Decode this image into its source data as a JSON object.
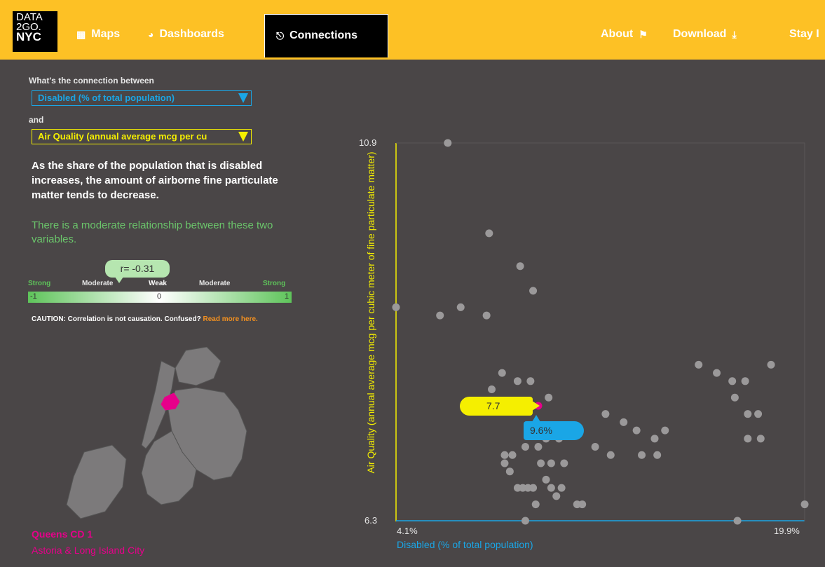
{
  "logo": {
    "line1": "DATA",
    "line2": "2GO.",
    "line3": "NYC"
  },
  "nav": {
    "maps": "Maps",
    "dashboards": "Dashboards",
    "connections": "Connections",
    "about": "About",
    "download": "Download",
    "stay": "Stay I"
  },
  "panel": {
    "question": "What's the connection between",
    "var1": "Disabled (% of total population)",
    "and": "and",
    "var2": "Air Quality (annual average mcg per cu",
    "statement": "As the share of the population that is disabled increases, the amount of airborne fine particulate matter tends to decrease.",
    "relationship": "There is a moderate relationship between these two variables.",
    "r_value": "r= -0.31",
    "r": -0.31,
    "scale_labels": [
      "Strong",
      "Moderate",
      "Weak",
      "Moderate",
      "Strong"
    ],
    "scale_min": "-1",
    "scale_mid": "0",
    "scale_max": "1",
    "caution": "CAUTION: Correlation is not causation. Confused?",
    "caution_link": "Read more here."
  },
  "selected": {
    "district": "Queens CD 1",
    "neighborhood": "Astoria & Long Island City",
    "x_label": "9.6%",
    "y_label": "7.7"
  },
  "colors": {
    "accent": "#fdc125",
    "x_var": "#1aa6e6",
    "y_var": "#f5ef00",
    "highlight": "#e6008a",
    "positive": "#6bc56b"
  },
  "chart_data": {
    "type": "scatter",
    "xlabel": "Disabled (% of total population)",
    "ylabel": "Air Quality (annual average mcg per cubic meter of fine particulate matter)",
    "x_min_label": "4.1%",
    "x_max_label": "19.9%",
    "y_min_label": "6.3",
    "y_max_label": "10.9",
    "xlim": [
      4.1,
      19.9
    ],
    "ylim": [
      6.3,
      10.9
    ],
    "highlight": {
      "x": 9.6,
      "y": 7.7
    },
    "points": [
      [
        6.1,
        10.9
      ],
      [
        7.7,
        9.8
      ],
      [
        8.9,
        9.4
      ],
      [
        9.4,
        9.1
      ],
      [
        4.1,
        8.9
      ],
      [
        5.8,
        8.8
      ],
      [
        6.6,
        8.9
      ],
      [
        7.6,
        8.8
      ],
      [
        8.2,
        8.1
      ],
      [
        7.8,
        7.9
      ],
      [
        8.8,
        8.0
      ],
      [
        9.3,
        8.0
      ],
      [
        10.0,
        7.8
      ],
      [
        15.8,
        8.2
      ],
      [
        18.6,
        8.2
      ],
      [
        16.5,
        8.1
      ],
      [
        17.1,
        8.0
      ],
      [
        17.6,
        8.0
      ],
      [
        17.2,
        7.8
      ],
      [
        17.7,
        7.6
      ],
      [
        18.1,
        7.6
      ],
      [
        12.2,
        7.6
      ],
      [
        12.9,
        7.5
      ],
      [
        13.4,
        7.4
      ],
      [
        14.5,
        7.4
      ],
      [
        17.7,
        7.3
      ],
      [
        18.2,
        7.3
      ],
      [
        14.1,
        7.3
      ],
      [
        9.9,
        7.3
      ],
      [
        10.4,
        7.3
      ],
      [
        11.8,
        7.2
      ],
      [
        12.4,
        7.1
      ],
      [
        13.6,
        7.1
      ],
      [
        14.2,
        7.1
      ],
      [
        8.3,
        7.1
      ],
      [
        8.6,
        7.1
      ],
      [
        9.1,
        7.2
      ],
      [
        9.6,
        7.2
      ],
      [
        10.1,
        7.0
      ],
      [
        10.6,
        7.0
      ],
      [
        8.3,
        7.0
      ],
      [
        8.5,
        6.9
      ],
      [
        9.7,
        7.0
      ],
      [
        8.8,
        6.7
      ],
      [
        9.2,
        6.7
      ],
      [
        9.0,
        6.7
      ],
      [
        9.4,
        6.7
      ],
      [
        9.9,
        6.8
      ],
      [
        10.1,
        6.7
      ],
      [
        10.5,
        6.7
      ],
      [
        10.3,
        6.6
      ],
      [
        11.1,
        6.5
      ],
      [
        9.5,
        6.5
      ],
      [
        11.3,
        6.5
      ],
      [
        9.1,
        6.3
      ],
      [
        19.9,
        6.5
      ],
      [
        17.3,
        6.3
      ]
    ]
  }
}
